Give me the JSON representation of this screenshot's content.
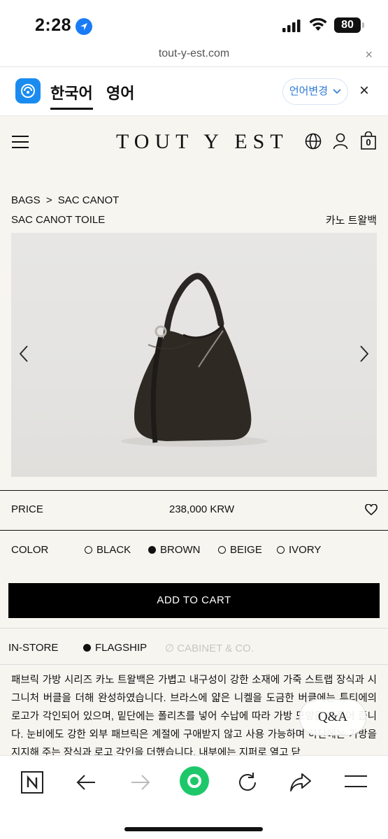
{
  "status_bar": {
    "time": "2:28",
    "battery": "80"
  },
  "url_bar": {
    "url": "tout-y-est.com",
    "close": "×"
  },
  "translate_bar": {
    "lang_active": "한국어",
    "lang_other": "영어",
    "change_label": "언어변경",
    "close": "×"
  },
  "header": {
    "logo": "TOUT Y EST",
    "cart_count": "0"
  },
  "breadcrumb": {
    "items": [
      "BAGS",
      ">",
      "SAC CANOT"
    ]
  },
  "product": {
    "title": "SAC CANOT TOILE",
    "title_ko": "카노 트왈백",
    "price_label": "PRICE",
    "price": "238,000 KRW",
    "color_label": "COLOR",
    "colors": [
      {
        "name": "BLACK",
        "selected": false
      },
      {
        "name": "BROWN",
        "selected": true
      },
      {
        "name": "BEIGE",
        "selected": false
      },
      {
        "name": "IVORY",
        "selected": false
      }
    ],
    "add_to_cart": "ADD TO CART",
    "instore_label": "IN-STORE",
    "stores": {
      "flagship": "FLAGSHIP",
      "cabinet": "∅ CABINET & CO."
    },
    "description": "패브릭 가방 시리즈 카노 트왈백은 가볍고 내구성이 강한 소재에 가죽 스트랩 장식과 시그니처 버클을 더해 완성하였습니다. 브라스에 얇은 니켈을 도금한 버클에는 투티에의 로고가 각인되어 있으며, 밑단에는 폴리츠를 넣어 수납에 따라 가방 모양을 만들어 줍니다. 눈비에도 강한 외부 패브릭은 계절에 구애받지 않고 사용 가능하며 하단에는 가방을 지지해 주는 장식과 로고 각인을 더했습니다. 내부에는 지퍼로 열고 닫"
  },
  "qa_badge": "Q&A",
  "colors": {
    "accent_blue": "#1a7cf5",
    "toolbar_green": "#1ec86a"
  }
}
